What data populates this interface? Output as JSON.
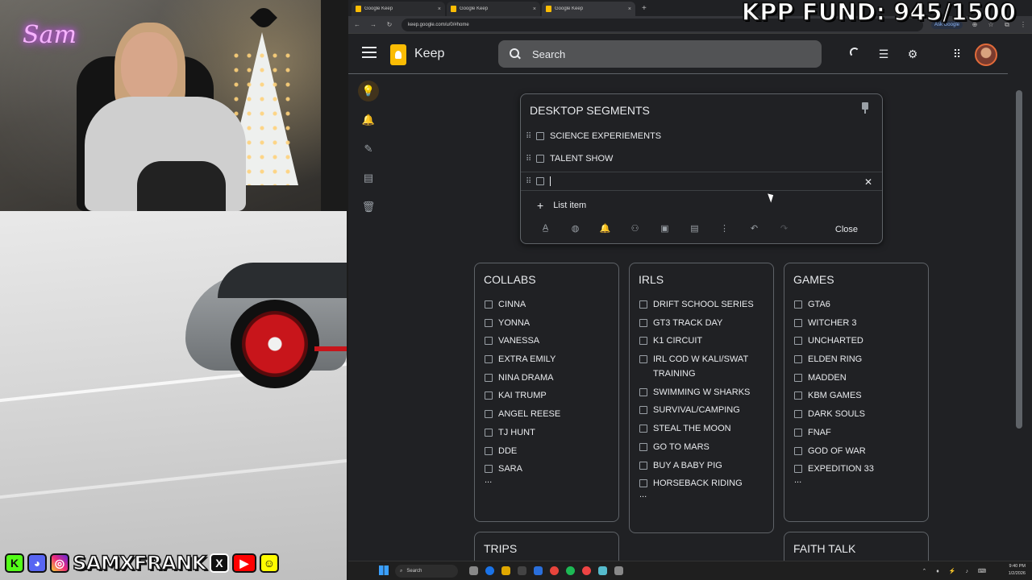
{
  "overlay": {
    "fund_text": "KPP FUND: 945/1500",
    "webcam_logo": "Sam",
    "social_handle": "SAMXFRANK"
  },
  "browser": {
    "tabs": [
      {
        "label": "Google Keep",
        "close": "×"
      },
      {
        "label": "Google Keep",
        "close": "×"
      },
      {
        "label": "Google Keep",
        "close": "×"
      }
    ],
    "new_tab": "+",
    "url": "keep.google.com/u/0/#home",
    "ask_label": "Ask Google"
  },
  "keep": {
    "app_title": "Keep",
    "search_placeholder": "Search",
    "header_icons": [
      "refresh-spinner-icon",
      "list-view-icon",
      "settings-gear-icon",
      "apps-grid-icon"
    ],
    "sidebar": [
      "lightbulb-notes-icon",
      "bell-reminders-icon",
      "pencil-edit-labels-icon",
      "archive-icon",
      "trash-icon"
    ],
    "editing_note": {
      "title": "DESKTOP SEGMENTS",
      "items": [
        "SCIENCE EXPERIEMENTS",
        "TALENT SHOW"
      ],
      "new_item_value": "",
      "add_label": "List item",
      "close_label": "Close",
      "tools": [
        "text-format-icon",
        "palette-icon",
        "remind-me-icon",
        "collaborator-icon",
        "add-image-icon",
        "archive-icon",
        "more-icon",
        "undo-icon",
        "redo-icon"
      ]
    },
    "notes": [
      {
        "title": "COLLABS",
        "items": [
          "CINNA",
          "YONNA",
          "VANESSA",
          "EXTRA EMILY",
          "NINA DRAMA",
          "KAI TRUMP",
          "ANGEL REESE",
          "TJ HUNT",
          "DDE",
          "SARA"
        ],
        "more": "..."
      },
      {
        "title": "IRLS",
        "items": [
          "DRIFT SCHOOL SERIES",
          "GT3 TRACK DAY",
          "K1 CIRCUIT",
          "IRL COD W KALI/SWAT TRAINING",
          "SWIMMING W SHARKS",
          "SURVIVAL/CAMPING",
          "STEAL THE MOON",
          "GO TO MARS",
          "BUY A BABY PIG",
          "HORSEBACK RIDING"
        ],
        "more": "..."
      },
      {
        "title": "GAMES",
        "items": [
          "GTA6",
          "WITCHER 3",
          "UNCHARTED",
          "ELDEN RING",
          "MADDEN",
          "KBM GAMES",
          "DARK SOULS",
          "FNAF",
          "GOD OF WAR",
          "EXPEDITION 33"
        ],
        "more": "..."
      },
      {
        "title": "TRIPS",
        "items": [],
        "more": ""
      },
      {
        "title": "FAITH TALK",
        "items": [],
        "more": ""
      }
    ]
  },
  "taskbar": {
    "search_label": "Search",
    "time": "9:40 PM",
    "date": "1/2/2026"
  }
}
